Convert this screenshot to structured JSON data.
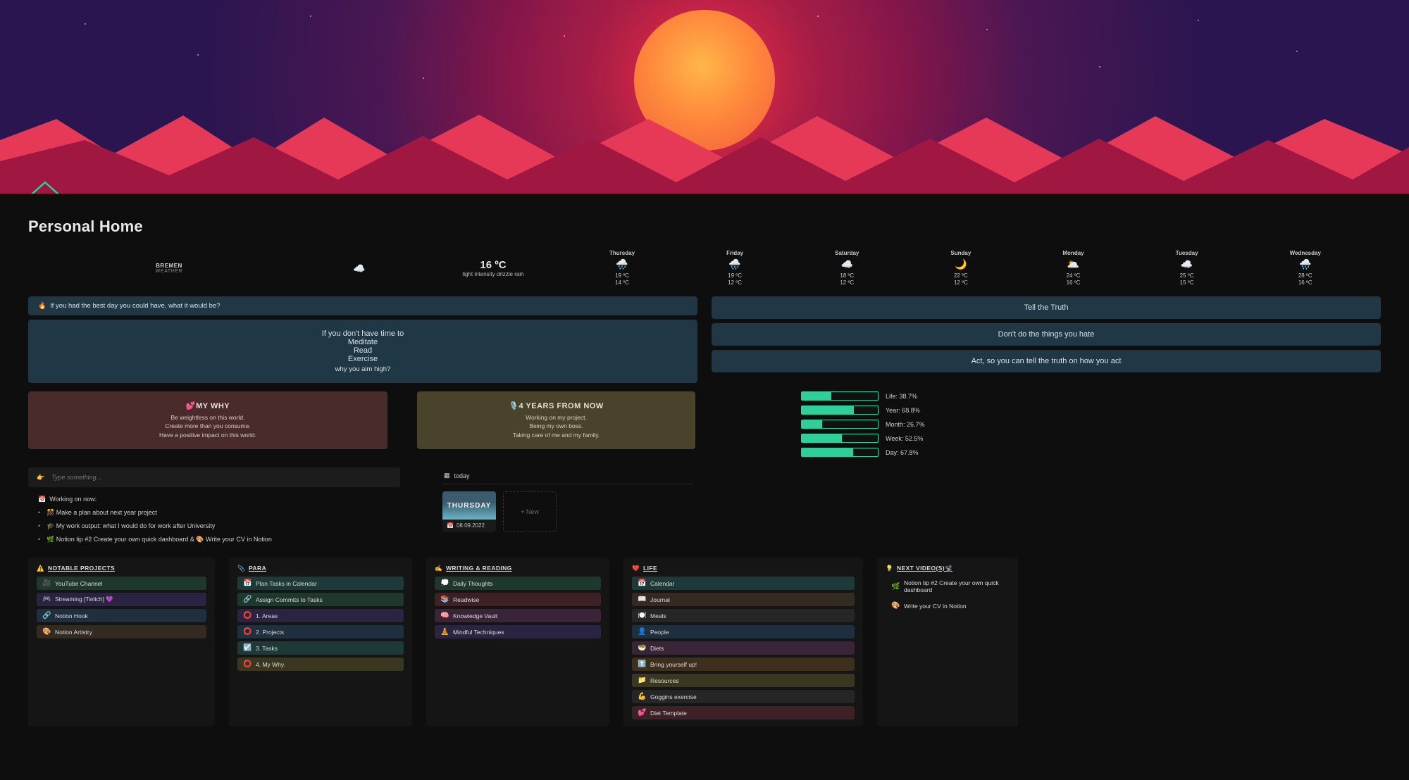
{
  "page_title": "Personal Home",
  "weather": {
    "city": "BREMEN",
    "sub": "WEATHER",
    "today_temp": "16 ºC",
    "today_desc": "light intensity drizzle rain",
    "days": [
      {
        "name": "Thursday",
        "icon": "🌧️",
        "hi": "19 ºC",
        "lo": "14 ºC"
      },
      {
        "name": "Friday",
        "icon": "🌧️",
        "hi": "19 ºC",
        "lo": "12 ºC"
      },
      {
        "name": "Saturday",
        "icon": "☁️",
        "hi": "18 ºC",
        "lo": "12 ºC"
      },
      {
        "name": "Sunday",
        "icon": "🌙",
        "hi": "22 ºC",
        "lo": "12 ºC"
      },
      {
        "name": "Monday",
        "icon": "🌥️",
        "hi": "24 ºC",
        "lo": "16 ºC"
      },
      {
        "name": "Tuesday",
        "icon": "☁️",
        "hi": "25 ºC",
        "lo": "15 ºC"
      },
      {
        "name": "Wednesday",
        "icon": "🌧️",
        "hi": "28 ºC",
        "lo": "16 ºC"
      }
    ]
  },
  "question": {
    "emoji": "🔥",
    "text": "If you had the best day you could have, what it would be?"
  },
  "mantra": {
    "l1": "If you don't have time to",
    "l2": "Meditate",
    "l3": "Read",
    "l4": "Exercise",
    "l5": "why you aim high?"
  },
  "truths": [
    "Tell the Truth",
    "Don't do the things you hate",
    "Act, so you can tell the truth on how you act"
  ],
  "why": {
    "title": "💕MY WHY",
    "l1": "Be weightless on this world.",
    "l2": "Create more than you consume.",
    "l3": "Have a positive impact on this world."
  },
  "future": {
    "title": "🎙️4 YEARS FROM NOW",
    "l1": "Working on my project.",
    "l2": "Being my own boss.",
    "l3": "Taking care of me and my family."
  },
  "progress": [
    {
      "label": "Life:",
      "value": "38.7%",
      "pct": 38.7
    },
    {
      "label": "Year:",
      "value": "68.8%",
      "pct": 68.8
    },
    {
      "label": "Month:",
      "value": "26.7%",
      "pct": 26.7
    },
    {
      "label": "Week:",
      "value": "52.5%",
      "pct": 52.5
    },
    {
      "label": "Day:",
      "value": "67.8%",
      "pct": 67.8
    }
  ],
  "typebox": {
    "emoji": "👉",
    "placeholder": "Type something..."
  },
  "working": {
    "emoji": "📅",
    "text": "Working on now:"
  },
  "bullets": [
    "🎊 Make a plan about next year project",
    "🎓 My work output: what I would do for work after University",
    "🌿 Notion tip #2 Create your own quick dashboard & 🎨 Write your CV in Notion"
  ],
  "today": {
    "tab": "today",
    "card": {
      "thumb_text": "THURSDAY",
      "emoji": "📅",
      "date": "08.09.2022"
    },
    "new_btn": "+  New"
  },
  "panels": {
    "np": {
      "title": "NOTABLE PROJECTS",
      "emoji": "⚠️",
      "items": [
        {
          "e": "🎥",
          "t": "YouTube Channel",
          "c": "c-green"
        },
        {
          "e": "🎮",
          "t": "Streaming [Twitch] 💜",
          "c": "c-purple"
        },
        {
          "e": "🔗",
          "t": "Notion Hook",
          "c": "c-blue"
        },
        {
          "e": "🎨",
          "t": "Notion Artistry",
          "c": "c-brown"
        }
      ]
    },
    "para": {
      "title": "PARA",
      "emoji": "📎",
      "items": [
        {
          "e": "📅",
          "t": "Plan Tasks in Calendar",
          "c": "c-teal"
        },
        {
          "e": "🔗",
          "t": "Assign Commits to Tasks",
          "c": "c-green"
        },
        {
          "e": "⭕",
          "t": "1. Areas",
          "c": "c-purple"
        },
        {
          "e": "⭕",
          "t": "2. Projects",
          "c": "c-blue"
        },
        {
          "e": "☑️",
          "t": "3. Tasks",
          "c": "c-teal"
        },
        {
          "e": "⭕",
          "t": "4. My Why.",
          "c": "c-yellow"
        }
      ]
    },
    "wr": {
      "title": "WRITING & READING",
      "emoji": "✍️",
      "items": [
        {
          "e": "💭",
          "t": "Daily Thoughts",
          "c": "c-green"
        },
        {
          "e": "📚",
          "t": "Readwise",
          "c": "c-red"
        },
        {
          "e": "🧠",
          "t": "Knowledge Vault",
          "c": "c-mag"
        },
        {
          "e": "🧘",
          "t": "Mindful Techniques",
          "c": "c-purple"
        }
      ]
    },
    "life": {
      "title": "LIFE",
      "emoji": "❤️",
      "items": [
        {
          "e": "📅",
          "t": "Calendar",
          "c": "c-teal"
        },
        {
          "e": "📖",
          "t": "Journal",
          "c": "c-brown"
        },
        {
          "e": "🍽️",
          "t": "Meals",
          "c": "c-gray"
        },
        {
          "e": "👤",
          "t": "People",
          "c": "c-blue"
        },
        {
          "e": "🥗",
          "t": "Diets",
          "c": "c-mag"
        },
        {
          "e": "⬆️",
          "t": "Bring yourself up!",
          "c": "c-orange"
        },
        {
          "e": "📁",
          "t": "Resources",
          "c": "c-yellow"
        },
        {
          "e": "💪",
          "t": "Goggins exercise",
          "c": "c-gray"
        },
        {
          "e": "💕",
          "t": "Diet Template",
          "c": "c-red"
        }
      ]
    },
    "nv": {
      "title": "NEXT VIDEO(S)📽️",
      "emoji": "💡",
      "items": [
        {
          "e": "🌿",
          "t": "Notion tip #2 Create your own quick dashboard",
          "c": ""
        },
        {
          "e": "🎨",
          "t": "Write your CV in Notion",
          "c": ""
        }
      ]
    }
  }
}
